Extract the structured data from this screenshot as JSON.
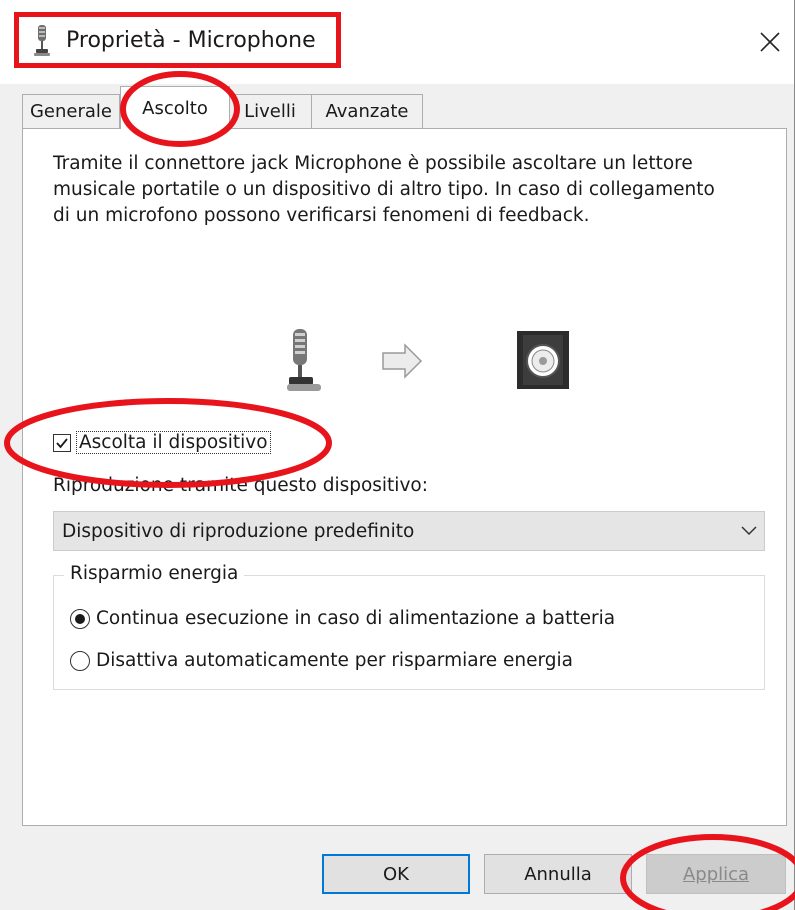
{
  "window": {
    "title": "Proprietà - Microphone",
    "close_icon": "close-icon"
  },
  "tabs": [
    {
      "label": "Generale",
      "active": false
    },
    {
      "label": "Ascolto",
      "active": true
    },
    {
      "label": "Livelli",
      "active": false
    },
    {
      "label": "Avanzate",
      "active": false
    }
  ],
  "listen": {
    "description": "Tramite il connettore jack Microphone è possibile ascoltare un lettore musicale portatile o un dispositivo di altro tipo. In caso di collegamento di un microfono possono verificarsi fenomeni di feedback.",
    "checkbox_label": "Ascolta il dispositivo",
    "checkbox_checked": true,
    "playback_label": "Riproduzione tramite questo dispositivo:",
    "playback_device": "Dispositivo di riproduzione predefinito"
  },
  "power": {
    "group_title": "Risparmio energia",
    "options": [
      {
        "label": "Continua esecuzione in caso di alimentazione a batteria",
        "selected": true
      },
      {
        "label": "Disattiva automaticamente per risparmiare energia",
        "selected": false
      }
    ]
  },
  "buttons": {
    "ok": "OK",
    "cancel": "Annulla",
    "apply": "Applica",
    "apply_enabled": false
  },
  "colors": {
    "annotation": "#e8141c",
    "focus": "#0078d7"
  }
}
